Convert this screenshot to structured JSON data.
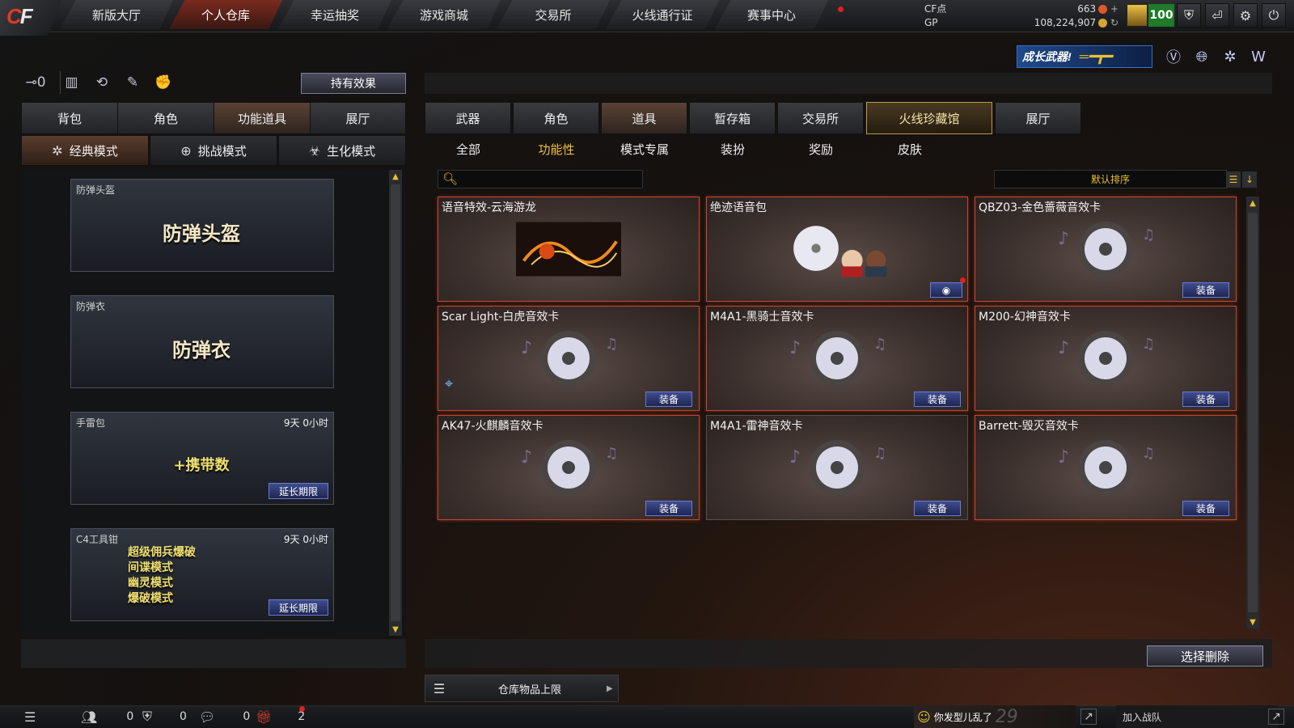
{
  "nav": {
    "logo": "CF",
    "tabs": [
      "新版大厅",
      "个人仓库",
      "幸运抽奖",
      "游戏商城",
      "交易所",
      "火线通行证",
      "赛事中心"
    ],
    "active_tab": "个人仓库"
  },
  "currency": {
    "cf_label": "CF点",
    "cf_value": "663",
    "gp_label": "GP",
    "gp_value": "108,224,907",
    "level": "100"
  },
  "banner": {
    "weapon_text": "成长武器!"
  },
  "left": {
    "hold_effect": "持有效果",
    "tabs": [
      "背包",
      "角色",
      "功能道具",
      "展厅"
    ],
    "active_tab": "功能道具",
    "modes": [
      {
        "icon": "classic-icon",
        "label": "经典模式"
      },
      {
        "icon": "challenge-icon",
        "label": "挑战模式"
      },
      {
        "icon": "zombie-icon",
        "label": "生化模式"
      }
    ],
    "active_mode": "经典模式",
    "items": [
      {
        "title": "防弹头盔",
        "art": "防弹头盔",
        "time": "",
        "action": ""
      },
      {
        "title": "防弹衣",
        "art": "防弹衣",
        "time": "",
        "action": ""
      },
      {
        "title": "手雷包",
        "art": "+携带数",
        "time": "9天 0小时",
        "action": "延长期限"
      },
      {
        "title": "C4工具钳",
        "art": "超级佣兵爆破\n间谍模式\n幽灵模式\n爆破模式",
        "time": "9天 0小时",
        "action": "延长期限"
      }
    ]
  },
  "right": {
    "tabs": [
      "武器",
      "角色",
      "道具",
      "暂存箱",
      "交易所",
      "火线珍藏馆",
      "展厅"
    ],
    "active_tab": "道具",
    "subtabs": [
      "全部",
      "功能性",
      "模式专属",
      "装扮",
      "奖励",
      "皮肤"
    ],
    "active_subtab": "功能性",
    "search_placeholder": "",
    "sort_label": "默认排序",
    "items": [
      {
        "name": "语音特效-云海游龙",
        "art": "dragon",
        "action": ""
      },
      {
        "name": "绝迹语音包",
        "art": "voicepack",
        "action": ""
      },
      {
        "name": "QBZ03-金色蔷薇音效卡",
        "art": "disc",
        "action": "装备"
      },
      {
        "name": "Scar Light-白虎音效卡",
        "art": "disc",
        "action": "装备"
      },
      {
        "name": "M4A1-黑骑士音效卡",
        "art": "disc",
        "action": "装备"
      },
      {
        "name": "M200-幻神音效卡",
        "art": "disc",
        "action": "装备"
      },
      {
        "name": "AK47-火麒麟音效卡",
        "art": "disc",
        "action": "装备"
      },
      {
        "name": "M4A1-雷神音效卡",
        "art": "disc",
        "action": "装备"
      },
      {
        "name": "Barrett-毁灭音效卡",
        "art": "disc",
        "action": "装备"
      }
    ],
    "delete_button": "选择删除",
    "storage_label": "仓库物品上限"
  },
  "bottom": {
    "counts": [
      "0",
      "0",
      "0",
      "2"
    ],
    "message": "你发型儿乱了",
    "message_num": "29",
    "join_team": "加入战队"
  }
}
